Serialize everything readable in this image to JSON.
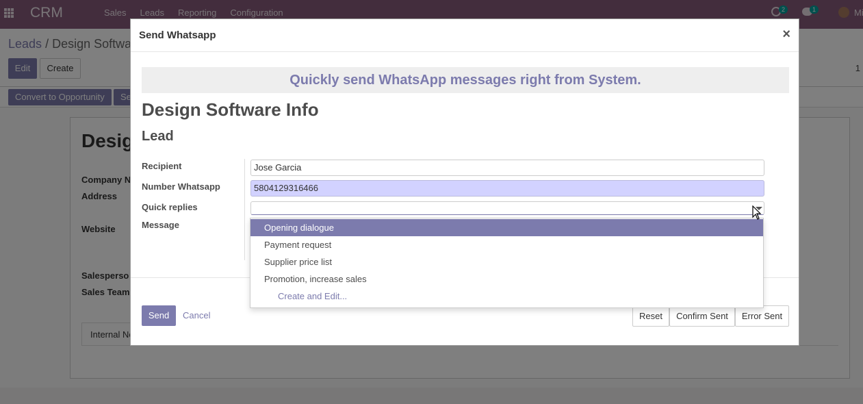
{
  "navbar": {
    "brand": "CRM",
    "menu": [
      "Sales",
      "Leads",
      "Reporting",
      "Configuration"
    ],
    "activity_count": "2",
    "message_count": "1",
    "user_name": "Mi"
  },
  "control_panel": {
    "breadcrumb_parent": "Leads",
    "breadcrumb_separator": "/",
    "breadcrumb_current": "Design Softwa",
    "edit_label": "Edit",
    "create_label": "Create",
    "pager": "1"
  },
  "statusbar": {
    "convert_label": "Convert to Opportunity",
    "second_label": "Se"
  },
  "sheet": {
    "title": "Desig",
    "labels": [
      "Company N",
      "Address",
      "Website",
      "Salesperso",
      "Sales Team"
    ],
    "tab_label": "Internal No"
  },
  "modal": {
    "title": "Send Whatsapp",
    "close_symbol": "×",
    "banner": "Quickly send WhatsApp messages right from System.",
    "record_title": "Design Software Info",
    "record_subtitle": "Lead",
    "fields": {
      "recipient_label": "Recipient",
      "recipient_value": "Jose Garcia",
      "number_label": "Number Whatsapp",
      "number_value": "5804129316466",
      "quick_replies_label": "Quick replies",
      "quick_replies_value": "",
      "message_label": "Message"
    },
    "buttons": {
      "send": "Send",
      "cancel": "Cancel",
      "reset": "Reset",
      "confirm_sent": "Confirm Sent",
      "error_sent": "Error Sent"
    }
  },
  "dropdown": {
    "options": [
      "Opening dialogue",
      "Payment request",
      "Supplier price list",
      "Promotion, increase sales"
    ],
    "highlighted_index": 0,
    "create_edit": "Create and Edit..."
  },
  "colors": {
    "brand": "#875a7b",
    "primary": "#7c7bad",
    "badge": "#00a09d",
    "field_highlight": "#d2d2ff"
  }
}
